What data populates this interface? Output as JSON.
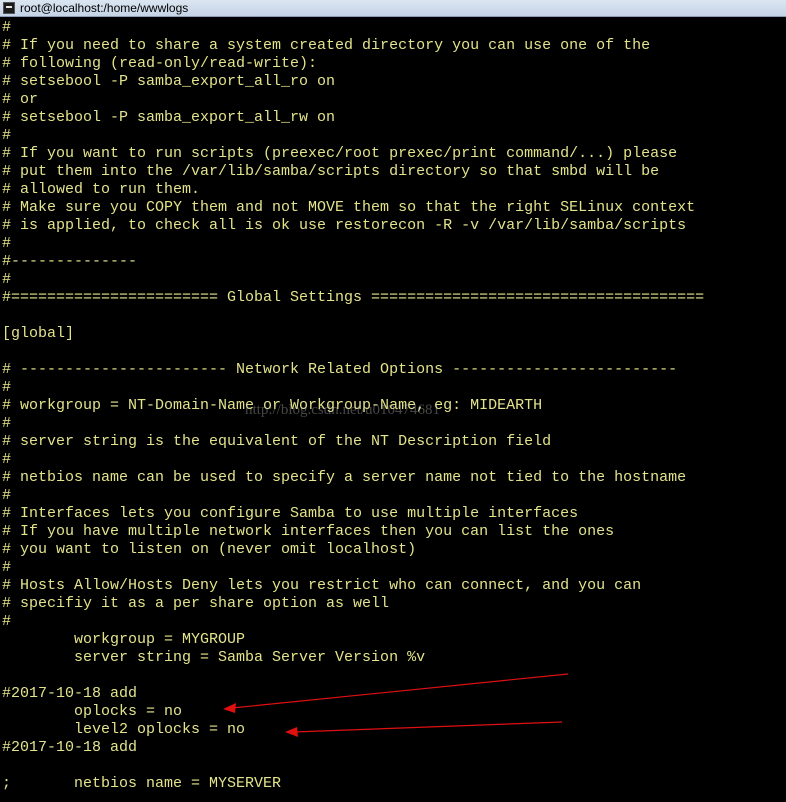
{
  "window": {
    "title": "root@localhost:/home/wwwlogs"
  },
  "terminal_lines": [
    "#",
    "# If you need to share a system created directory you can use one of the",
    "# following (read-only/read-write):",
    "# setsebool -P samba_export_all_ro on",
    "# or",
    "# setsebool -P samba_export_all_rw on",
    "#",
    "# If you want to run scripts (preexec/root prexec/print command/...) please",
    "# put them into the /var/lib/samba/scripts directory so that smbd will be",
    "# allowed to run them.",
    "# Make sure you COPY them and not MOVE them so that the right SELinux context",
    "# is applied, to check all is ok use restorecon -R -v /var/lib/samba/scripts",
    "#",
    "#--------------",
    "#",
    "#======================= Global Settings =====================================",
    "",
    "[global]",
    "",
    "# ----------------------- Network Related Options -------------------------",
    "#",
    "# workgroup = NT-Domain-Name or Workgroup-Name, eg: MIDEARTH",
    "#",
    "# server string is the equivalent of the NT Description field",
    "#",
    "# netbios name can be used to specify a server name not tied to the hostname",
    "#",
    "# Interfaces lets you configure Samba to use multiple interfaces",
    "# If you have multiple network interfaces then you can list the ones",
    "# you want to listen on (never omit localhost)",
    "#",
    "# Hosts Allow/Hosts Deny lets you restrict who can connect, and you can",
    "# specifiy it as a per share option as well",
    "#",
    "        workgroup = MYGROUP",
    "        server string = Samba Server Version %v",
    "",
    "#2017-10-18 add",
    "        oplocks = no",
    "        level2 oplocks = no",
    "#2017-10-18 add",
    "",
    ";       netbios name = MYSERVER"
  ],
  "watermark": "http://blog.csdn.net/u010474681",
  "colors": {
    "terminal_bg": "#000000",
    "terminal_text": "#e3e38c",
    "annotation_arrow": "#e01010"
  }
}
